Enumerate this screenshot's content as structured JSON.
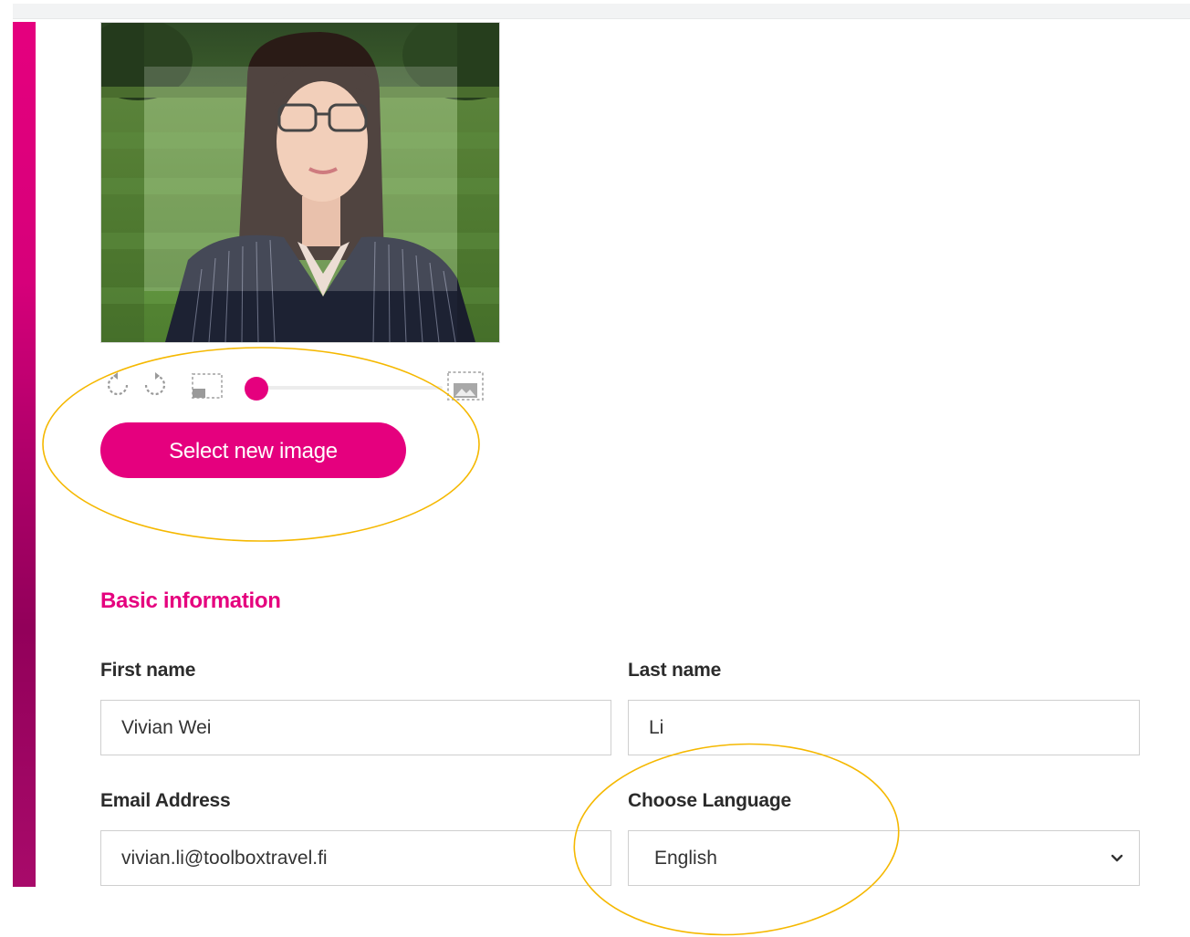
{
  "colors": {
    "accent": "#e5007e",
    "annotation": "#f5b800"
  },
  "photo": {
    "subject": "profile photo of woman with glasses in dark pinstripe blazer on lawn",
    "crop_area_visible": true
  },
  "image_controls": {
    "rotate_left_icon": "rotate-left-icon",
    "rotate_right_icon": "rotate-right-icon",
    "zoom_out_icon": "zoom-out-icon",
    "zoom_in_icon": "zoom-in-icon",
    "zoom_level_fraction": 0.05
  },
  "buttons": {
    "select_new_image": "Select new image"
  },
  "basic_information": {
    "title": "Basic information",
    "first_name": {
      "label": "First name",
      "value": "Vivian Wei"
    },
    "last_name": {
      "label": "Last name",
      "value": "Li"
    },
    "email": {
      "label": "Email Address",
      "value": "vivian.li@toolboxtravel.fi"
    },
    "language": {
      "label": "Choose Language",
      "value": "English"
    }
  }
}
